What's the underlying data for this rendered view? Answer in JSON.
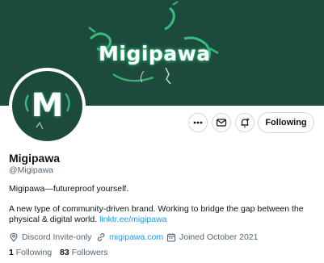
{
  "banner": {
    "text": "Migipawa"
  },
  "avatar": {
    "letter": "M"
  },
  "actions": {
    "follow_label": "Following"
  },
  "profile": {
    "name": "Migipawa",
    "handle": "@Migipawa",
    "bio_line1": "Migipawa—futureproof yourself.",
    "bio_line2": "A new type of community-driven brand. Working to bridge the gap between the physical & digital world.",
    "bio_link": "linktr.ee/migipawa"
  },
  "meta": {
    "location": "Discord Invite-only",
    "website": "migipawa.com",
    "joined": "Joined October 2021"
  },
  "stats": {
    "following_count": "1",
    "following_label": "Following",
    "followers_count": "83",
    "followers_label": "Followers"
  },
  "colors": {
    "banner_bg": "#1c4a3d",
    "glow": "#3fd08a",
    "link": "#1d9bf0"
  },
  "icons": [
    "more-icon",
    "message-icon",
    "notify-icon",
    "location-icon",
    "link-icon",
    "calendar-icon"
  ]
}
